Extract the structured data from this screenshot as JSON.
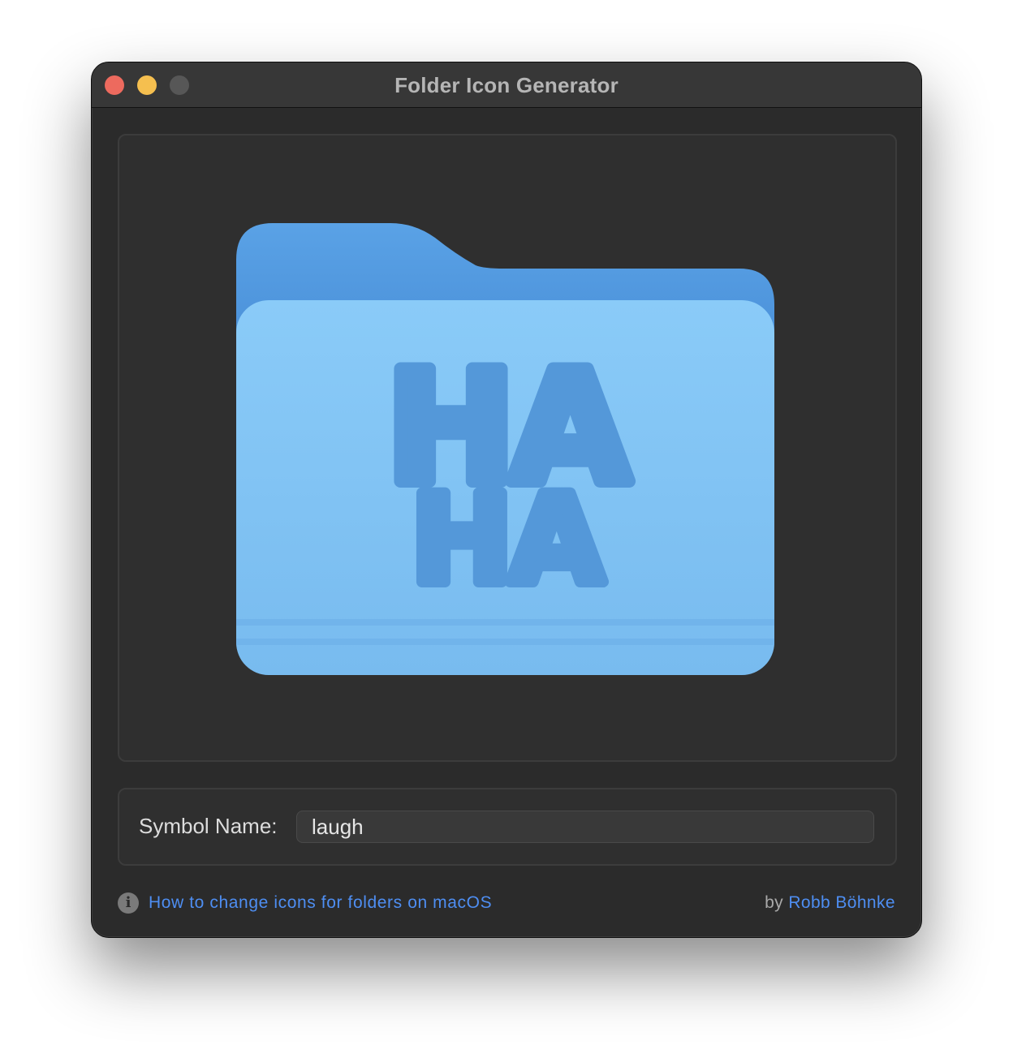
{
  "window": {
    "title": "Folder Icon Generator"
  },
  "preview": {
    "symbol_lines": [
      "HA",
      "HA"
    ],
    "folder_colors": {
      "back": "#4a90d9",
      "front": "#82c3f4",
      "glyph": "#5498d9"
    }
  },
  "form": {
    "symbol_label": "Symbol Name:",
    "symbol_value": "laugh"
  },
  "footer": {
    "info_icon": "info-circle-icon",
    "help_link": "How to change icons for folders on macOS",
    "by_label": "by",
    "author": "Robb Böhnke"
  },
  "colors": {
    "link": "#4e8ef2",
    "window_bg": "#2b2b2b",
    "titlebar": "#373737"
  }
}
